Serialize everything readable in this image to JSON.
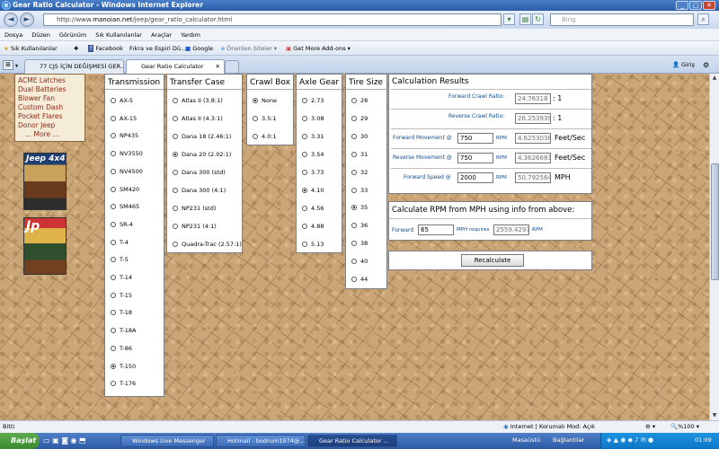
{
  "window": {
    "title": "Gear Ratio Calculator - Windows Internet Explorer"
  },
  "address": {
    "prefix": "http://www.",
    "host": "manoian.net",
    "path": "/jeep/gear_ratio_calculator.html",
    "search_placeholder": "Bing"
  },
  "menu": [
    "Dosya",
    "Düzen",
    "Görünüm",
    "Sık Kullanılanlar",
    "Araçlar",
    "Yardım"
  ],
  "favbar": {
    "favorites": "Sık Kullanılanlar",
    "facebook": "Facebook",
    "fikra": "Fıkra ve Espiri Dü...",
    "google": "Google",
    "onerilen": "Önerilen Siteler",
    "addons": "Get More Add-ons"
  },
  "tabs": [
    {
      "label": "77 CJ5 İÇİN DEĞİŞMESİ GER..."
    },
    {
      "label": "Gear Ratio Calculator"
    }
  ],
  "toolbar_right": "Giriş",
  "left_menu": [
    "ACME Latches",
    "Dual Batteries",
    "Blower Fan",
    "Custom Dash",
    "Pocket Flares",
    "Donor Jeep",
    "... More ..."
  ],
  "magazines": [
    "Jeep 4x4",
    "Jp"
  ],
  "transmission": {
    "header": "Transmission",
    "options": [
      "AX-5",
      "AX-15",
      "NP435",
      "NV3550",
      "NV4500",
      "SM420",
      "SM465",
      "SR-4",
      "T-4",
      "T-5",
      "T-14",
      "T-15",
      "T-18",
      "T-18A",
      "T-86",
      "T-150",
      "T-176"
    ],
    "selected": 15
  },
  "transfer": {
    "header": "Transfer Case",
    "options": [
      "Atlas II (3.8:1)",
      "Atlas II (4.3:1)",
      "Dana 18 (2.46:1)",
      "Dana 20 (2.02:1)",
      "Dana 300 (std)",
      "Dana 300 (4:1)",
      "NP231 (std)",
      "NP231 (4:1)",
      "Quadra-Trac (2.57:1)"
    ],
    "selected": 3
  },
  "crawl": {
    "header": "Crawl Box",
    "options": [
      "None",
      "3.5:1",
      "4.0:1"
    ],
    "selected": 0
  },
  "axle": {
    "header": "Axle Gear",
    "options": [
      "2.73",
      "3.08",
      "3.31",
      "3.54",
      "3.73",
      "4.10",
      "4.56",
      "4.88",
      "5.13"
    ],
    "selected": 5
  },
  "tire": {
    "header": "Tire Size",
    "options": [
      "28",
      "29",
      "30",
      "31",
      "32",
      "33",
      "35",
      "36",
      "38",
      "40",
      "44"
    ],
    "selected": 6
  },
  "results": {
    "header": "Calculation Results",
    "fwd_crawl_label": "Forward Crawl Ratio:",
    "fwd_crawl_value": "24.76318",
    "fwd_crawl_unit": ": 1",
    "rev_crawl_label": "Reverse Crawl Ratio:",
    "rev_crawl_value": "26.253939",
    "rev_crawl_unit": ": 1",
    "fwd_move_label": "Forward Movement @",
    "fwd_move_rpm": "750",
    "fwd_move_value": "4.6253038",
    "fwd_move_unit": "Feet/Sec",
    "rev_move_label": "Reverse Movement @",
    "rev_move_rpm": "750",
    "rev_move_value": "4.3626683",
    "rev_move_unit": "Feet/Sec",
    "fwd_speed_label": "Forward Speed @",
    "fwd_speed_rpm": "2000",
    "fwd_speed_value": "50.792564",
    "fwd_speed_unit": "MPH",
    "rpm_label": "RPM"
  },
  "mph": {
    "header": "Calculate RPM from MPH using info from above:",
    "fwd_label": "Forward",
    "mph_value": "65",
    "requires_label": "MPH requires",
    "rpm_value": "2559.4297",
    "rpm_label": "RPM"
  },
  "recalc_label": "Recalculate",
  "status": {
    "left": "Bitti",
    "zone": "Internet | Korumalı Mod: Açık",
    "zoom": "%100"
  },
  "taskbar": {
    "start": "Başlat",
    "items": [
      "Windows Live Messenger",
      "Hotmail - bodrum1974@...",
      "Gear Ratio Calculator ..."
    ],
    "desktop": "Masaüstü",
    "links": "Bağlantılar",
    "clock": "01:09"
  }
}
